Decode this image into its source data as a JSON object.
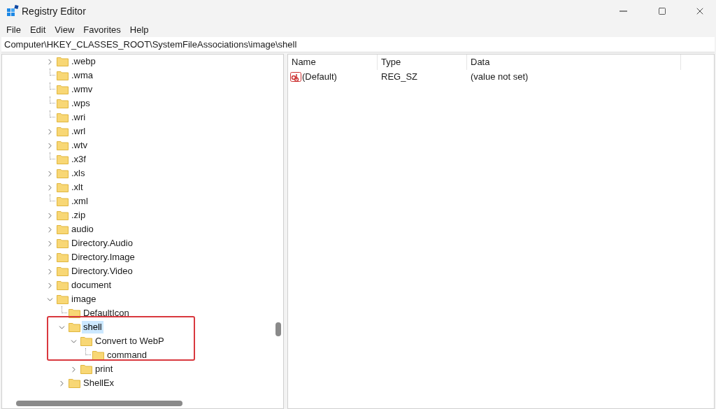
{
  "window": {
    "title": "Registry Editor"
  },
  "menu": [
    "File",
    "Edit",
    "View",
    "Favorites",
    "Help"
  ],
  "address": "Computer\\HKEY_CLASSES_ROOT\\SystemFileAssociations\\image\\shell",
  "tree": [
    {
      "label": ".webp",
      "kind": "branch",
      "expanded": false,
      "selected": false
    },
    {
      "label": ".wma",
      "kind": "leaf",
      "selected": false
    },
    {
      "label": ".wmv",
      "kind": "leaf",
      "selected": false
    },
    {
      "label": ".wps",
      "kind": "leaf",
      "selected": false
    },
    {
      "label": ".wri",
      "kind": "leaf",
      "selected": false
    },
    {
      "label": ".wrl",
      "kind": "branch",
      "expanded": false,
      "selected": false
    },
    {
      "label": ".wtv",
      "kind": "branch",
      "expanded": false,
      "selected": false
    },
    {
      "label": ".x3f",
      "kind": "leaf",
      "selected": false
    },
    {
      "label": ".xls",
      "kind": "branch",
      "expanded": false,
      "selected": false
    },
    {
      "label": ".xlt",
      "kind": "branch",
      "expanded": false,
      "selected": false
    },
    {
      "label": ".xml",
      "kind": "leaf",
      "selected": false
    },
    {
      "label": ".zip",
      "kind": "branch",
      "expanded": false,
      "selected": false
    },
    {
      "label": "audio",
      "kind": "branch",
      "expanded": false,
      "selected": false
    },
    {
      "label": "Directory.Audio",
      "kind": "branch",
      "expanded": false,
      "selected": false
    },
    {
      "label": "Directory.Image",
      "kind": "branch",
      "expanded": false,
      "selected": false
    },
    {
      "label": "Directory.Video",
      "kind": "branch",
      "expanded": false,
      "selected": false
    },
    {
      "label": "document",
      "kind": "branch",
      "expanded": false,
      "selected": false
    },
    {
      "label": "image",
      "kind": "branch",
      "expanded": true,
      "selected": false,
      "children": [
        {
          "label": "DefaultIcon",
          "kind": "leaf",
          "selected": false
        },
        {
          "label": "shell",
          "kind": "branch",
          "expanded": true,
          "selected": true,
          "children": [
            {
              "label": "Convert to WebP",
              "kind": "branch",
              "expanded": true,
              "selected": false,
              "children": [
                {
                  "label": "command",
                  "kind": "leaf",
                  "selected": false
                }
              ]
            },
            {
              "label": "print",
              "kind": "branch",
              "expanded": false,
              "selected": false
            }
          ]
        },
        {
          "label": "ShellEx",
          "kind": "branch",
          "expanded": false,
          "selected": false
        }
      ]
    }
  ],
  "values": {
    "columns": [
      "Name",
      "Type",
      "Data"
    ],
    "rows": [
      {
        "name": "(Default)",
        "type": "REG_SZ",
        "data": "(value not set)"
      }
    ]
  }
}
